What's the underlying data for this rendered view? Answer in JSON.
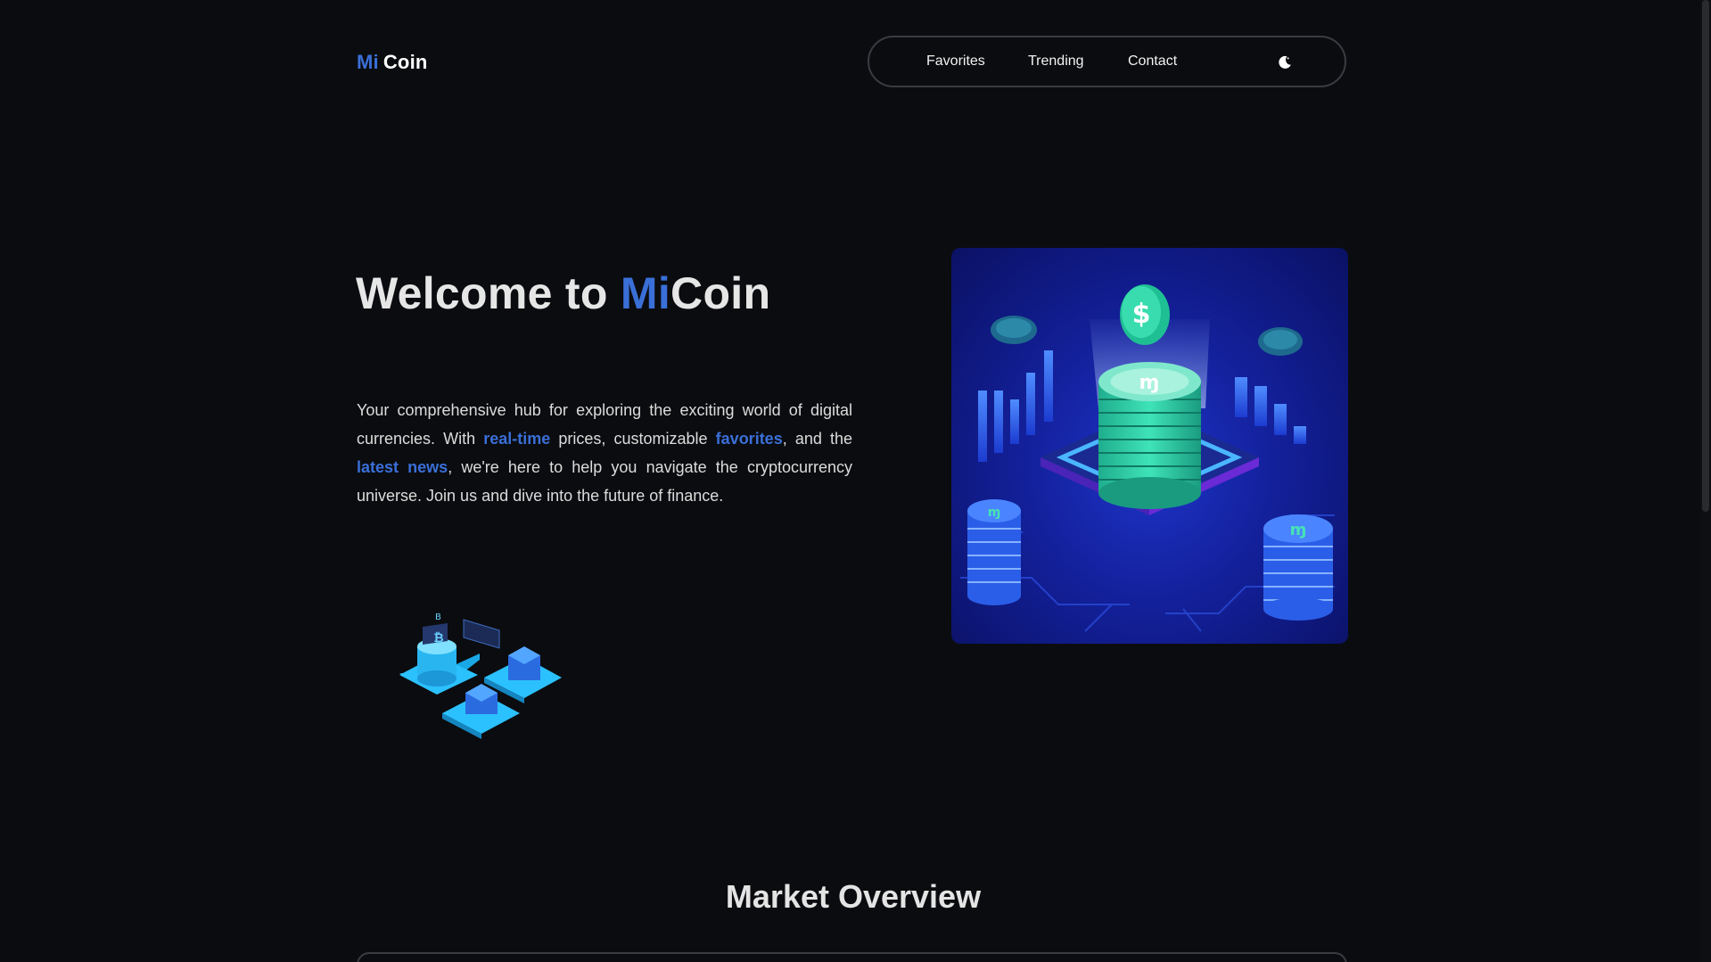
{
  "brand": {
    "prefix": "Mi",
    "suffix": "Coin",
    "accent_color": "#3a6fd8"
  },
  "nav": {
    "items": [
      "Favorites",
      "Trending",
      "Contact"
    ],
    "theme_toggle_icon": "moon-icon"
  },
  "hero": {
    "title_start": "Welcome to ",
    "title_accent": "Mi",
    "title_end": "Coin",
    "text_part1": "Your comprehensive hub for exploring the exciting world of digital currencies. With ",
    "link_realtime": "real-time",
    "text_part2": " prices, customizable ",
    "link_favorites": "favorites",
    "text_part3": ", and the ",
    "link_news": "latest news",
    "text_part4": ", we're here to help you navigate the cryptocurrency universe. Join us and dive into the future of finance.",
    "main_image_icon": "crypto-coin-stack-illustration",
    "small_image_icon": "crypto-servers-illustration"
  },
  "market": {
    "title": "Market Overview"
  }
}
